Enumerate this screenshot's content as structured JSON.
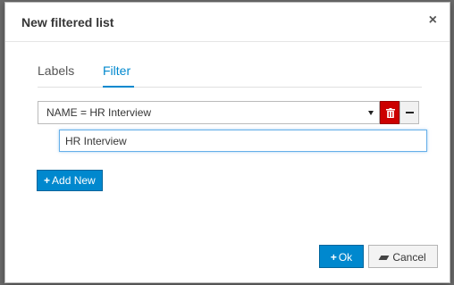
{
  "dialog": {
    "title": "New filtered list",
    "close_label": "×"
  },
  "tabs": [
    {
      "label": "Labels",
      "active": false
    },
    {
      "label": "Filter",
      "active": true
    }
  ],
  "filter": {
    "selected_condition": "NAME = HR Interview",
    "value": "HR Interview",
    "delete_icon": "trash-icon",
    "remove_icon": "minus-icon"
  },
  "actions": {
    "add_new_label": "Add New",
    "add_new_icon": "+",
    "ok_label": "Ok",
    "ok_icon": "+",
    "cancel_label": "Cancel"
  },
  "colors": {
    "accent": "#0088ce",
    "danger": "#cc0000"
  }
}
